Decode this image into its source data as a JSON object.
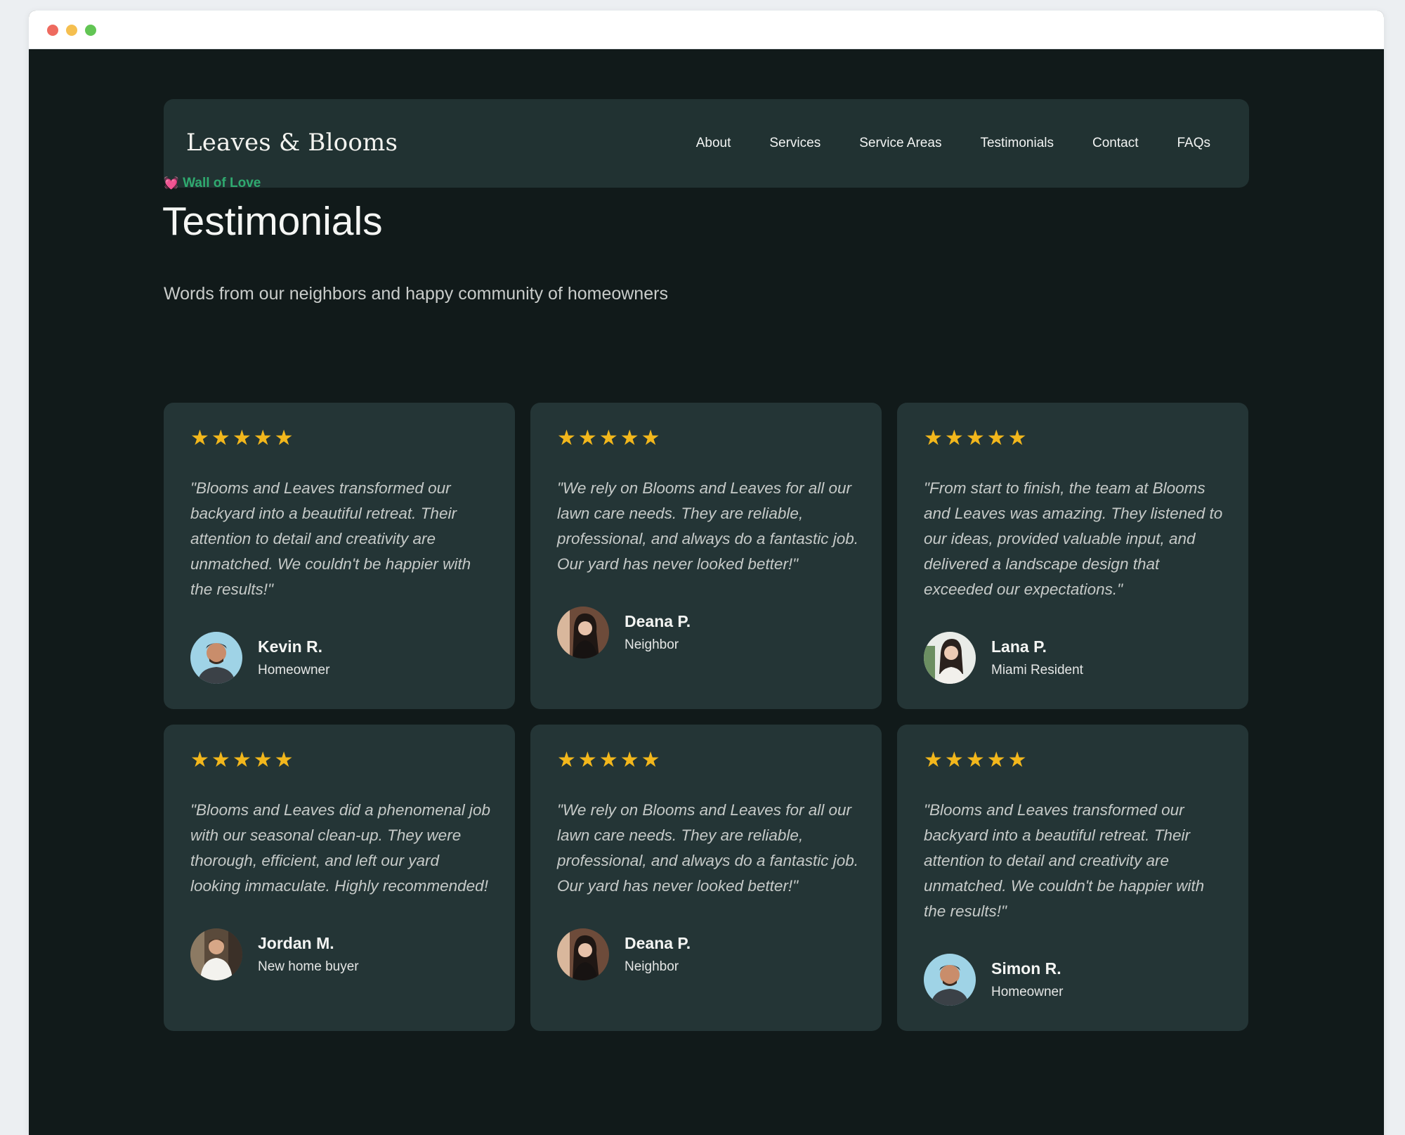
{
  "brand": "Leaves & Blooms",
  "nav": [
    "About",
    "Services",
    "Service Areas",
    "Testimonials",
    "Contact",
    "FAQs"
  ],
  "eyebrow": {
    "icon": "💓",
    "text": "Wall of Love"
  },
  "heading": "Testimonials",
  "subheading": "Words from our neighbors and happy community of homeowners",
  "star_color": "#f2b71c",
  "accent_green": "#2faa6f",
  "testimonials": [
    {
      "rating": 5,
      "quote": "\"Blooms and Leaves transformed our backyard into a beautiful retreat. Their attention to detail and creativity are unmatched. We couldn't be happier with the results!\"",
      "name": "Kevin R.",
      "role": "Homeowner",
      "avatar": "man-light-background"
    },
    {
      "rating": 5,
      "quote": "\"We rely on Blooms and Leaves for all our lawn care needs. They are reliable, professional, and always do a fantastic job. Our yard has never looked better!\"",
      "name": "Deana P.",
      "role": "Neighbor",
      "avatar": "woman-dark-hair"
    },
    {
      "rating": 5,
      "quote": "\"From start to finish, the team at Blooms and Leaves was amazing. They listened to our ideas, provided valuable input, and delivered a landscape design that exceeded our expectations.\"",
      "name": "Lana P.",
      "role": "Miami Resident",
      "avatar": "woman-light-background"
    },
    {
      "rating": 5,
      "quote": "\"Blooms and Leaves did a phenomenal job with our seasonal clean-up. They were thorough, efficient, and left our yard looking immaculate. Highly recommended!",
      "name": "Jordan M.",
      "role": "New home buyer",
      "avatar": "man-white-shirt"
    },
    {
      "rating": 5,
      "quote": "\"We rely on Blooms and Leaves for all our lawn care needs. They are reliable, professional, and always do a fantastic job. Our yard has never looked better!\"",
      "name": "Deana P.",
      "role": "Neighbor",
      "avatar": "woman-dark-hair"
    },
    {
      "rating": 5,
      "quote": "\"Blooms and Leaves transformed our backyard into a beautiful retreat. Their attention to detail and creativity are unmatched. We couldn't be happier with the results!\"",
      "name": "Simon R.",
      "role": "Homeowner",
      "avatar": "man-light-background"
    }
  ]
}
